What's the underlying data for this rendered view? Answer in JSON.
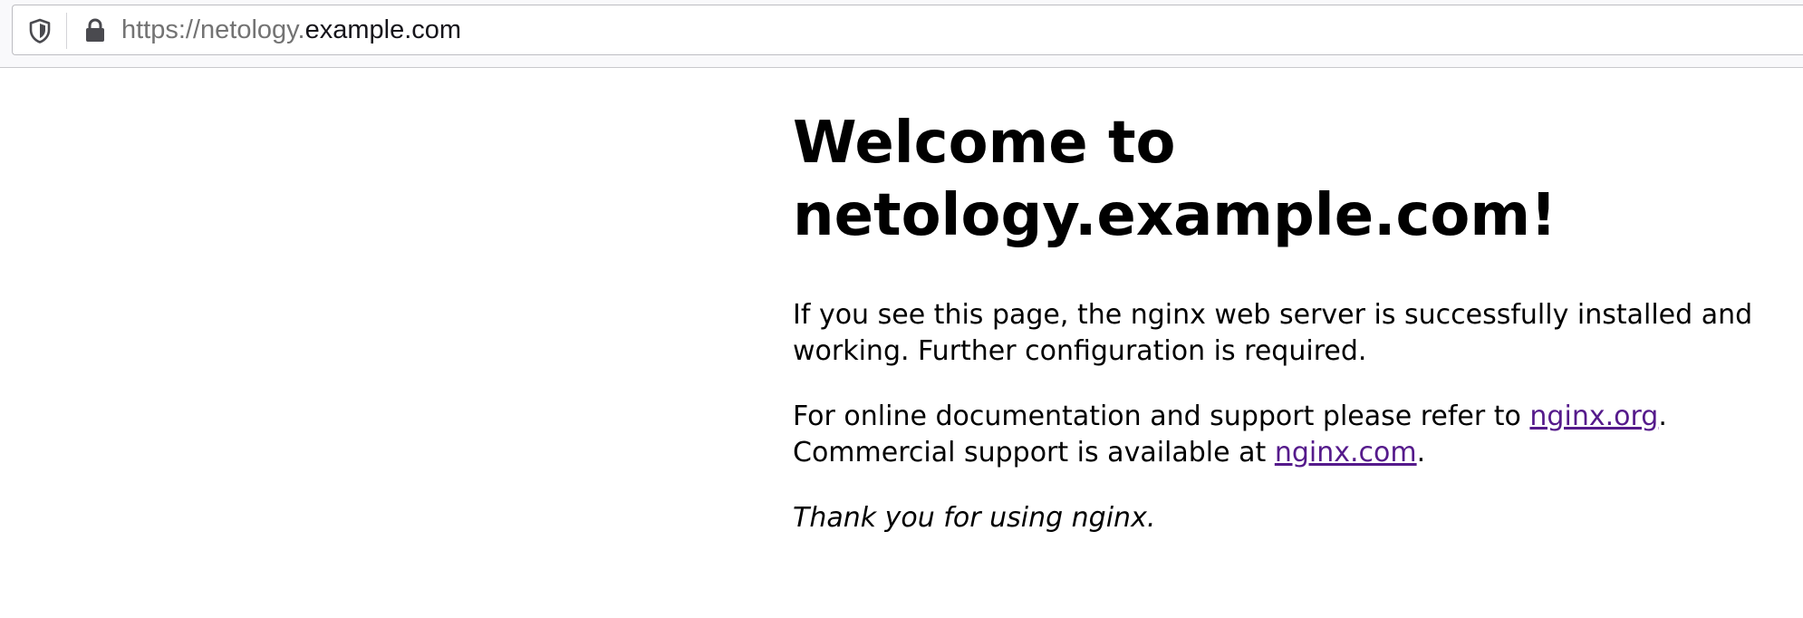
{
  "browser": {
    "url_prefix": "https://netology.",
    "url_domain": "example.com",
    "icons": {
      "tracking_protection": "shield-icon",
      "security": "lock-icon"
    }
  },
  "page": {
    "heading": "Welcome to netology.example.com!",
    "paragraph1": "If you see this page, the nginx web server is successfully installed and working. Further configuration is required.",
    "paragraph2": {
      "text_before_link1": "For online documentation and support please refer to ",
      "link1_text": "nginx.org",
      "text_after_link1": ".",
      "text_before_link2": "Commercial support is available at ",
      "link2_text": "nginx.com",
      "text_after_link2": "."
    },
    "thanks": "Thank you for using nginx.",
    "link_color": "#551a8b"
  }
}
